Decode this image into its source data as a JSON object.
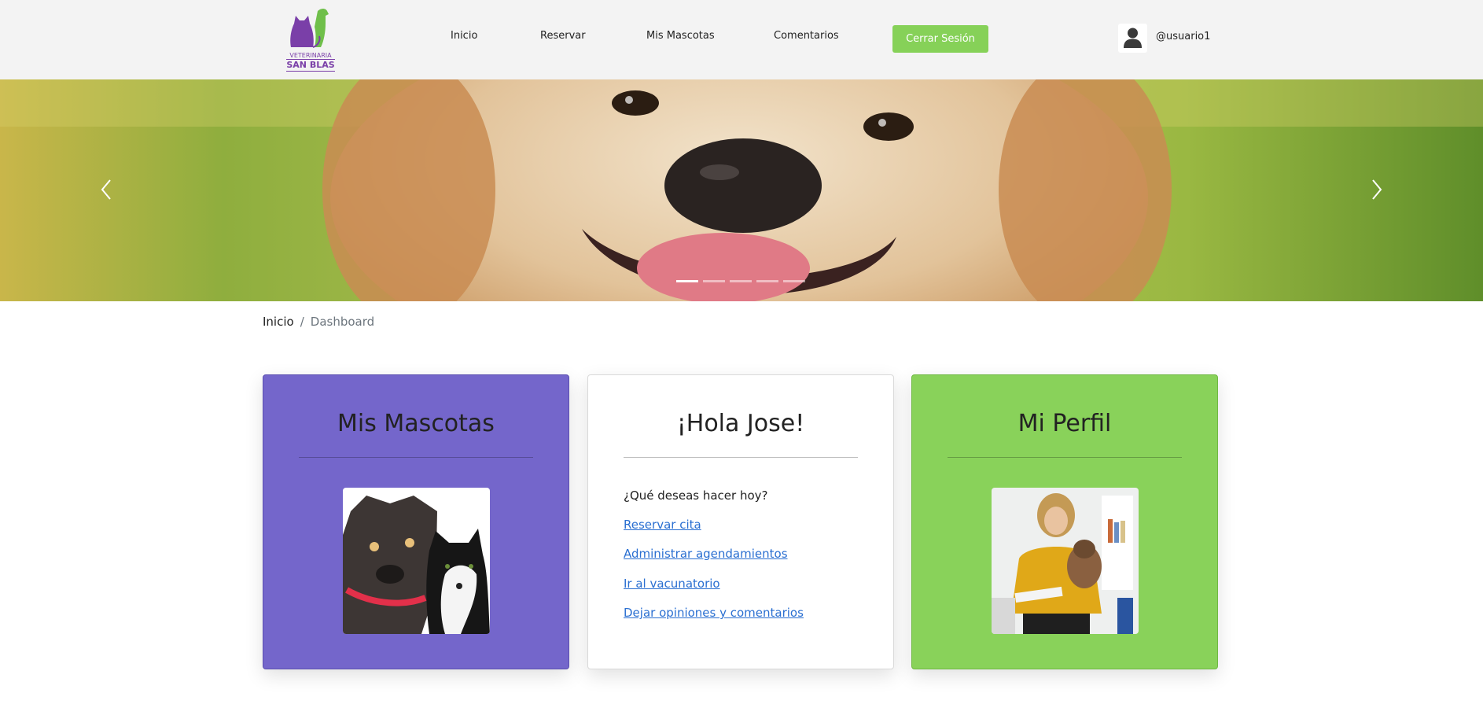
{
  "brand": {
    "logo_line1": "VETERINARIA",
    "logo_line2": "SAN BLAS",
    "colors": {
      "purple": "#7a3fa8",
      "green": "#6fbf4a"
    }
  },
  "nav": {
    "items": [
      {
        "label": "Inicio"
      },
      {
        "label": "Reservar"
      },
      {
        "label": "Mis Mascotas"
      },
      {
        "label": "Comentarios"
      }
    ],
    "logout_label": "Cerrar Sesión",
    "username": "@usuario1",
    "avatar_icon": "user-icon"
  },
  "carousel": {
    "indicator_count": 5,
    "active_index": 0,
    "prev_icon": "chevron-left-icon",
    "next_icon": "chevron-right-icon"
  },
  "breadcrumb": {
    "home": "Inicio",
    "separator": "/",
    "current": "Dashboard"
  },
  "cards": {
    "pets": {
      "title": "Mis Mascotas",
      "color": "#7466cb"
    },
    "hello": {
      "title": "¡Hola Jose!",
      "question": "¿Qué deseas hacer hoy?",
      "links": [
        "Reservar cita",
        "Administrar agendamientos",
        "Ir al vacunatorio",
        "Dejar opiniones y comentarios"
      ]
    },
    "profile": {
      "title": "Mi Perfil",
      "color": "#89d25a"
    }
  }
}
